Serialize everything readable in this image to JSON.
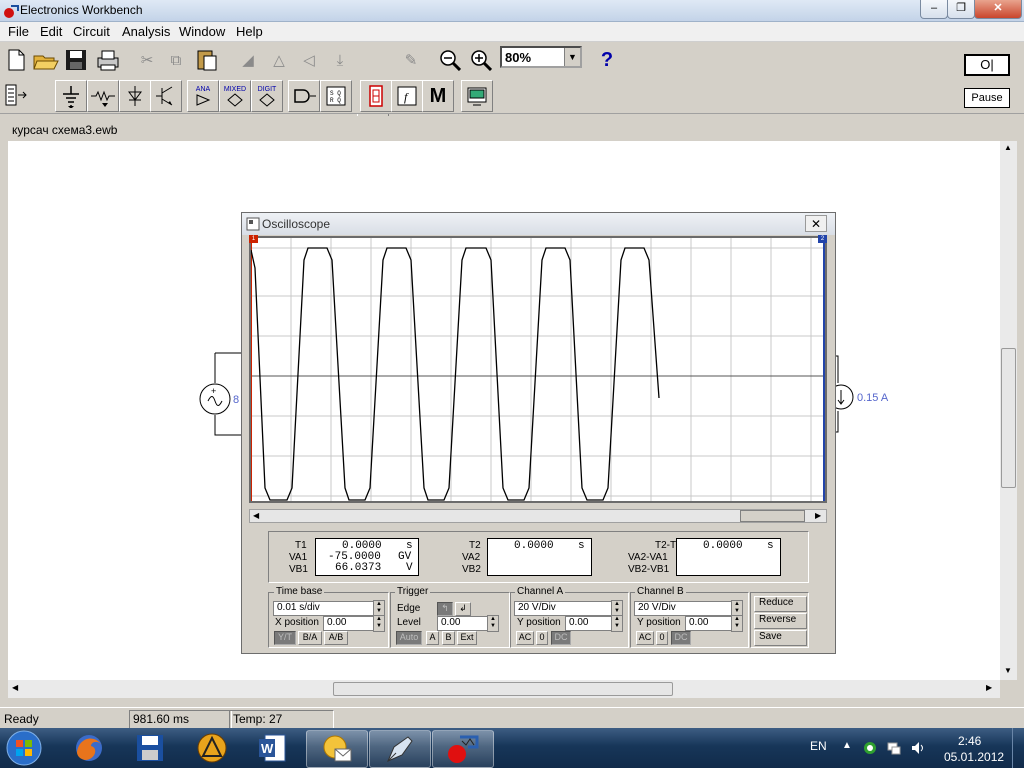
{
  "app": {
    "title": "Electronics Workbench"
  },
  "menu": [
    "File",
    "Edit",
    "Circuit",
    "Analysis",
    "Window",
    "Help"
  ],
  "toolbar": {
    "zoom": "80%",
    "help": "?",
    "pause_label": "Pause",
    "power_label": "O|",
    "parts": {
      "ana": "ANA",
      "mixed": "MIXED",
      "digit": "DIGIT",
      "m_label": "M"
    }
  },
  "document": {
    "title": "курсач схема3.ewb"
  },
  "circuit": {
    "ammeter_value": "0.15 A",
    "source_label": "8"
  },
  "oscilloscope": {
    "title": "Oscilloscope",
    "cursor1_label": "1",
    "cursor2_label": "2",
    "readout1": {
      "labels": [
        "T1",
        "VA1",
        "VB1"
      ],
      "values": [
        "0.0000",
        "-75.0000",
        "66.0373"
      ],
      "units": [
        "s",
        "GV",
        "V"
      ]
    },
    "readout2": {
      "labels": [
        "T2",
        "VA2",
        "VB2"
      ],
      "values": [
        "0.0000",
        "",
        ""
      ],
      "units": [
        "s",
        "",
        ""
      ]
    },
    "readout3": {
      "labels": [
        "T2-T1",
        "VA2-VA1",
        "VB2-VB1"
      ],
      "values": [
        "0.0000",
        "",
        ""
      ],
      "units": [
        "s",
        "",
        ""
      ]
    },
    "timebase": {
      "title": "Time base",
      "value": "0.01 s/div",
      "xpos_label": "X position",
      "xpos_value": "0.00",
      "buttons": [
        "Y/T",
        "B/A",
        "A/B"
      ]
    },
    "trigger": {
      "title": "Trigger",
      "edge_label": "Edge",
      "level_label": "Level",
      "level_value": "0.00",
      "buttons": [
        "Auto",
        "A",
        "B",
        "Ext"
      ]
    },
    "channel_a": {
      "title": "Channel A",
      "value": "20 V/Div",
      "ypos_label": "Y position",
      "ypos_value": "0.00",
      "buttons": [
        "AC",
        "0",
        "DC"
      ]
    },
    "channel_b": {
      "title": "Channel B",
      "value": "20 V/Div",
      "ypos_label": "Y position",
      "ypos_value": "0.00",
      "buttons": [
        "AC",
        "0",
        "DC"
      ]
    },
    "side_buttons": [
      "Reduce",
      "Reverse",
      "Save"
    ]
  },
  "status": {
    "state": "Ready",
    "time": "981.60 ms",
    "temp": "Temp:  27"
  },
  "taskbar": {
    "lang": "EN",
    "clock_time": "2:46",
    "clock_date": "05.01.2012"
  },
  "colors": {
    "title_gradient_top": "#dfe9f5",
    "trace": "#000000",
    "cursor1": "#cc2200",
    "cursor2": "#2244aa",
    "meter_text": "#5566cc",
    "taskbar": "#173659"
  }
}
